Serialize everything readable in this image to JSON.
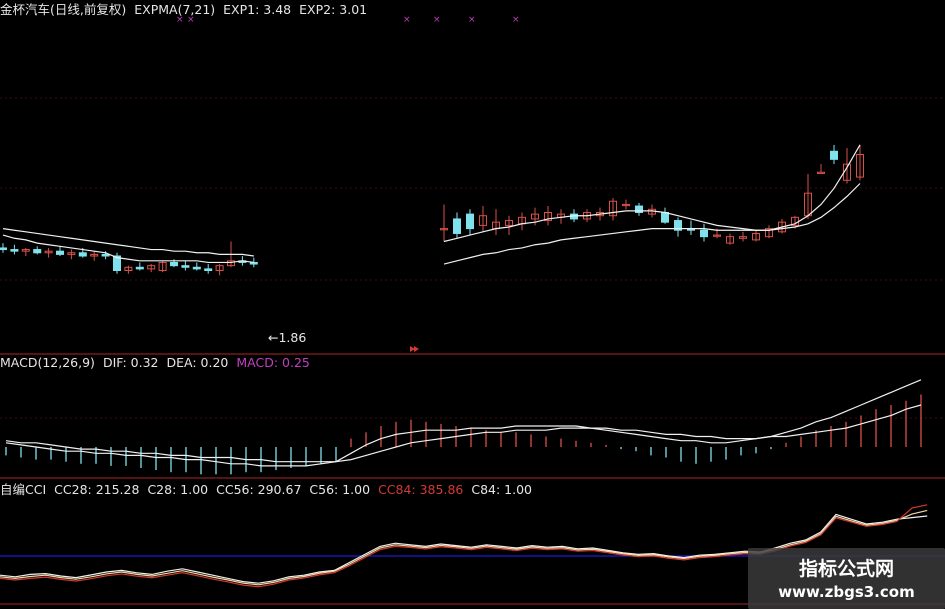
{
  "colors": {
    "background": "#000000",
    "up": "#d9504a",
    "down": "#7fe3ee",
    "line_white": "#f0f0f0",
    "separator": "#8a1f1f",
    "magenta": "#c040c0",
    "cc84": "#d23a32",
    "zero_line": "#1a1ad8"
  },
  "price_panel": {
    "title": "金杯汽车(日线,前复权)",
    "indicator": "EXPMA(7,21)",
    "exp1": "EXP1: 3.48",
    "exp2": "EXP2: 3.01",
    "min_annotation": "←1.86"
  },
  "macd_panel": {
    "title": "MACD(12,26,9)",
    "dif": "DIF: 0.32",
    "dea": "DEA: 0.20",
    "macd": "MACD: 0.25"
  },
  "cci_panel": {
    "title": "自编CCI",
    "cc28": "CC28: 215.28",
    "c28": "C28: 1.00",
    "cc56": "CC56: 290.67",
    "c56": "C56: 1.00",
    "cc84": "CC84: 385.86",
    "c84": "C84: 1.00"
  },
  "watermark": {
    "title": "指标公式网",
    "url": "www.zbgs3.com",
    "icon": "logo-mark"
  },
  "chart_data": [
    {
      "type": "candlestick",
      "title": "金杯汽车(日线,前复权)",
      "note": "Daily OHLC of a stock in two segments separated by a trading halt; most recent bars cut off at right edge",
      "segments": [
        {
          "name": "before_halt",
          "candles": [
            {
              "o": 2.78,
              "h": 2.81,
              "l": 2.75,
              "c": 2.77
            },
            {
              "o": 2.77,
              "h": 2.8,
              "l": 2.74,
              "c": 2.76
            },
            {
              "o": 2.76,
              "h": 2.78,
              "l": 2.73,
              "c": 2.77
            },
            {
              "o": 2.77,
              "h": 2.79,
              "l": 2.74,
              "c": 2.75
            },
            {
              "o": 2.75,
              "h": 2.78,
              "l": 2.72,
              "c": 2.76
            },
            {
              "o": 2.76,
              "h": 2.79,
              "l": 2.73,
              "c": 2.74
            },
            {
              "o": 2.74,
              "h": 2.77,
              "l": 2.71,
              "c": 2.75
            },
            {
              "o": 2.75,
              "h": 2.78,
              "l": 2.72,
              "c": 2.73
            },
            {
              "o": 2.73,
              "h": 2.76,
              "l": 2.7,
              "c": 2.74
            },
            {
              "o": 2.74,
              "h": 2.76,
              "l": 2.71,
              "c": 2.73
            },
            {
              "o": 2.73,
              "h": 2.75,
              "l": 2.62,
              "c": 2.64
            },
            {
              "o": 2.64,
              "h": 2.67,
              "l": 2.62,
              "c": 2.66
            },
            {
              "o": 2.66,
              "h": 2.69,
              "l": 2.64,
              "c": 2.65
            },
            {
              "o": 2.65,
              "h": 2.68,
              "l": 2.63,
              "c": 2.67
            },
            {
              "o": 2.64,
              "h": 2.7,
              "l": 2.63,
              "c": 2.69
            },
            {
              "o": 2.69,
              "h": 2.71,
              "l": 2.66,
              "c": 2.67
            },
            {
              "o": 2.67,
              "h": 2.7,
              "l": 2.64,
              "c": 2.66
            },
            {
              "o": 2.66,
              "h": 2.69,
              "l": 2.64,
              "c": 2.65
            },
            {
              "o": 2.65,
              "h": 2.68,
              "l": 2.62,
              "c": 2.64
            },
            {
              "o": 2.64,
              "h": 2.68,
              "l": 2.61,
              "c": 2.67
            },
            {
              "o": 2.67,
              "h": 2.82,
              "l": 2.66,
              "c": 2.7
            },
            {
              "o": 2.7,
              "h": 2.73,
              "l": 2.67,
              "c": 2.69
            },
            {
              "o": 2.69,
              "h": 2.72,
              "l": 2.66,
              "c": 2.68
            }
          ],
          "exp1": [
            2.86,
            2.84,
            2.83,
            2.81,
            2.8,
            2.79,
            2.78,
            2.77,
            2.76,
            2.75,
            2.72,
            2.71,
            2.7,
            2.7,
            2.7,
            2.7,
            2.7,
            2.7,
            2.69,
            2.69,
            2.69,
            2.7,
            2.69
          ],
          "exp2": [
            2.9,
            2.89,
            2.88,
            2.87,
            2.86,
            2.85,
            2.84,
            2.83,
            2.82,
            2.81,
            2.8,
            2.79,
            2.78,
            2.77,
            2.77,
            2.76,
            2.76,
            2.75,
            2.75,
            2.74,
            2.74,
            2.74,
            2.73
          ]
        },
        {
          "name": "after_halt",
          "candles": [
            {
              "o": 2.9,
              "h": 3.05,
              "l": 2.82,
              "c": 2.9
            },
            {
              "o": 2.96,
              "h": 3.0,
              "l": 2.84,
              "c": 2.87
            },
            {
              "o": 2.99,
              "h": 3.02,
              "l": 2.86,
              "c": 2.9
            },
            {
              "o": 2.92,
              "h": 3.04,
              "l": 2.88,
              "c": 2.98
            },
            {
              "o": 2.9,
              "h": 3.02,
              "l": 2.86,
              "c": 2.94
            },
            {
              "o": 2.92,
              "h": 2.98,
              "l": 2.86,
              "c": 2.95
            },
            {
              "o": 2.93,
              "h": 3.0,
              "l": 2.89,
              "c": 2.97
            },
            {
              "o": 2.96,
              "h": 3.03,
              "l": 2.92,
              "c": 2.99
            },
            {
              "o": 2.95,
              "h": 3.04,
              "l": 2.92,
              "c": 3.0
            },
            {
              "o": 2.97,
              "h": 3.02,
              "l": 2.93,
              "c": 2.99
            },
            {
              "o": 2.99,
              "h": 3.02,
              "l": 2.94,
              "c": 2.96
            },
            {
              "o": 2.96,
              "h": 3.02,
              "l": 2.94,
              "c": 3.0
            },
            {
              "o": 2.98,
              "h": 3.03,
              "l": 2.95,
              "c": 3.0
            },
            {
              "o": 2.98,
              "h": 3.09,
              "l": 2.95,
              "c": 3.07
            },
            {
              "o": 3.05,
              "h": 3.08,
              "l": 3.02,
              "c": 3.05
            },
            {
              "o": 3.04,
              "h": 3.06,
              "l": 2.98,
              "c": 3.0
            },
            {
              "o": 2.99,
              "h": 3.05,
              "l": 2.97,
              "c": 3.02
            },
            {
              "o": 3.0,
              "h": 3.03,
              "l": 2.93,
              "c": 2.94
            },
            {
              "o": 2.95,
              "h": 2.97,
              "l": 2.85,
              "c": 2.89
            },
            {
              "o": 2.9,
              "h": 2.95,
              "l": 2.86,
              "c": 2.89
            },
            {
              "o": 2.89,
              "h": 2.93,
              "l": 2.82,
              "c": 2.85
            },
            {
              "o": 2.86,
              "h": 2.9,
              "l": 2.84,
              "c": 2.86
            },
            {
              "o": 2.81,
              "h": 2.87,
              "l": 2.8,
              "c": 2.85
            },
            {
              "o": 2.84,
              "h": 2.88,
              "l": 2.82,
              "c": 2.85
            },
            {
              "o": 2.83,
              "h": 2.89,
              "l": 2.82,
              "c": 2.87
            },
            {
              "o": 2.85,
              "h": 2.92,
              "l": 2.84,
              "c": 2.9
            },
            {
              "o": 2.88,
              "h": 2.96,
              "l": 2.87,
              "c": 2.94
            },
            {
              "o": 2.92,
              "h": 2.98,
              "l": 2.9,
              "c": 2.97
            },
            {
              "o": 2.98,
              "h": 3.24,
              "l": 2.96,
              "c": 3.12
            },
            {
              "o": 3.25,
              "h": 3.3,
              "l": 3.25,
              "c": 3.25
            },
            {
              "o": 3.38,
              "h": 3.42,
              "l": 3.3,
              "c": 3.33
            },
            {
              "o": 3.2,
              "h": 3.4,
              "l": 3.18,
              "c": 3.3
            },
            {
              "o": 3.22,
              "h": 3.42,
              "l": 3.2,
              "c": 3.36
            }
          ],
          "exp1": [
            2.82,
            2.84,
            2.86,
            2.88,
            2.9,
            2.91,
            2.93,
            2.94,
            2.96,
            2.97,
            2.98,
            2.98,
            2.99,
            3.0,
            3.01,
            3.01,
            3.01,
            3.0,
            2.98,
            2.96,
            2.94,
            2.92,
            2.91,
            2.9,
            2.89,
            2.89,
            2.91,
            2.93,
            2.98,
            3.05,
            3.15,
            3.28,
            3.42
          ],
          "exp2": [
            2.68,
            2.7,
            2.72,
            2.74,
            2.75,
            2.77,
            2.78,
            2.8,
            2.81,
            2.83,
            2.84,
            2.85,
            2.86,
            2.87,
            2.88,
            2.89,
            2.9,
            2.9,
            2.9,
            2.9,
            2.9,
            2.89,
            2.89,
            2.89,
            2.89,
            2.89,
            2.9,
            2.91,
            2.93,
            2.97,
            3.03,
            3.1,
            3.18
          ]
        }
      ],
      "min_label": "←1.86"
    },
    {
      "type": "bar",
      "title": "MACD(12,26,9)",
      "series": [
        {
          "name": "MACD",
          "kind": "histogram",
          "values": [
            -0.04,
            -0.05,
            -0.06,
            -0.06,
            -0.07,
            -0.08,
            -0.08,
            -0.09,
            -0.09,
            -0.1,
            -0.11,
            -0.12,
            -0.12,
            -0.13,
            -0.13,
            -0.13,
            -0.12,
            -0.12,
            -0.11,
            -0.1,
            -0.09,
            -0.08,
            -0.07,
            0.04,
            0.07,
            0.1,
            0.12,
            0.13,
            0.12,
            0.11,
            0.1,
            0.09,
            0.08,
            0.07,
            0.07,
            0.06,
            0.05,
            0.04,
            0.03,
            0.02,
            0.01,
            -0.01,
            -0.02,
            -0.04,
            -0.05,
            -0.07,
            -0.08,
            -0.07,
            -0.06,
            -0.04,
            -0.03,
            -0.01,
            0.02,
            0.05,
            0.08,
            0.1,
            0.12,
            0.15,
            0.18,
            0.2,
            0.22,
            0.25
          ]
        },
        {
          "name": "DIF",
          "kind": "line",
          "values": [
            0.02,
            0.01,
            0.0,
            -0.01,
            -0.02,
            -0.02,
            -0.03,
            -0.03,
            -0.04,
            -0.04,
            -0.05,
            -0.05,
            -0.06,
            -0.06,
            -0.07,
            -0.08,
            -0.08,
            -0.09,
            -0.09,
            -0.09,
            -0.09,
            -0.08,
            -0.07,
            -0.03,
            0.01,
            0.04,
            0.06,
            0.07,
            0.08,
            0.08,
            0.08,
            0.09,
            0.09,
            0.09,
            0.1,
            0.1,
            0.1,
            0.1,
            0.1,
            0.09,
            0.08,
            0.07,
            0.06,
            0.05,
            0.04,
            0.03,
            0.03,
            0.02,
            0.02,
            0.03,
            0.04,
            0.05,
            0.07,
            0.09,
            0.12,
            0.14,
            0.17,
            0.2,
            0.23,
            0.26,
            0.29,
            0.32
          ]
        },
        {
          "name": "DEA",
          "kind": "line",
          "values": [
            0.03,
            0.02,
            0.02,
            0.01,
            0.0,
            -0.01,
            -0.01,
            -0.02,
            -0.02,
            -0.03,
            -0.03,
            -0.04,
            -0.04,
            -0.05,
            -0.05,
            -0.05,
            -0.06,
            -0.06,
            -0.07,
            -0.07,
            -0.07,
            -0.07,
            -0.07,
            -0.06,
            -0.04,
            -0.02,
            0.0,
            0.02,
            0.03,
            0.04,
            0.05,
            0.06,
            0.07,
            0.07,
            0.08,
            0.08,
            0.08,
            0.09,
            0.09,
            0.09,
            0.09,
            0.08,
            0.08,
            0.07,
            0.06,
            0.06,
            0.05,
            0.05,
            0.04,
            0.04,
            0.04,
            0.05,
            0.05,
            0.06,
            0.07,
            0.08,
            0.09,
            0.11,
            0.13,
            0.15,
            0.18,
            0.2
          ]
        }
      ]
    },
    {
      "type": "line",
      "title": "自编CCI",
      "series": [
        {
          "name": "CC28",
          "values": [
            -120,
            -130,
            -115,
            -110,
            -125,
            -135,
            -118,
            -100,
            -90,
            -105,
            -115,
            -95,
            -80,
            -100,
            -120,
            -140,
            -160,
            -170,
            -155,
            -130,
            -120,
            -100,
            -90,
            -40,
            10,
            60,
            80,
            70,
            60,
            75,
            65,
            55,
            70,
            60,
            50,
            65,
            55,
            60,
            45,
            50,
            35,
            20,
            10,
            15,
            0,
            -10,
            5,
            10,
            20,
            30,
            25,
            50,
            80,
            100,
            150,
            260,
            230,
            200,
            210,
            230,
            240,
            250
          ]
        },
        {
          "name": "CC56",
          "values": [
            -130,
            -140,
            -128,
            -120,
            -135,
            -145,
            -130,
            -112,
            -100,
            -115,
            -125,
            -108,
            -92,
            -112,
            -132,
            -150,
            -170,
            -180,
            -165,
            -140,
            -128,
            -108,
            -95,
            -50,
            0,
            50,
            70,
            62,
            52,
            66,
            58,
            48,
            62,
            52,
            42,
            56,
            48,
            52,
            38,
            42,
            28,
            14,
            4,
            8,
            -6,
            -16,
            -2,
            4,
            14,
            22,
            18,
            40,
            70,
            92,
            140,
            248,
            220,
            192,
            202,
            222,
            262,
            285
          ]
        },
        {
          "name": "CC84",
          "color_note": "red",
          "values": [
            -140,
            -150,
            -140,
            -132,
            -146,
            -156,
            -142,
            -124,
            -112,
            -126,
            -136,
            -120,
            -104,
            -124,
            -144,
            -162,
            -182,
            -192,
            -176,
            -150,
            -138,
            -118,
            -104,
            -60,
            -10,
            40,
            60,
            54,
            44,
            58,
            50,
            40,
            54,
            44,
            34,
            48,
            40,
            44,
            30,
            34,
            20,
            6,
            -4,
            0,
            -14,
            -24,
            -10,
            -4,
            6,
            14,
            10,
            32,
            62,
            84,
            132,
            238,
            212,
            186,
            196,
            216,
            300,
            320
          ]
        },
        {
          "name": "C28",
          "values": [
            1.0
          ]
        },
        {
          "name": "C56",
          "values": [
            1.0
          ]
        },
        {
          "name": "C84",
          "values": [
            1.0
          ]
        }
      ]
    }
  ]
}
